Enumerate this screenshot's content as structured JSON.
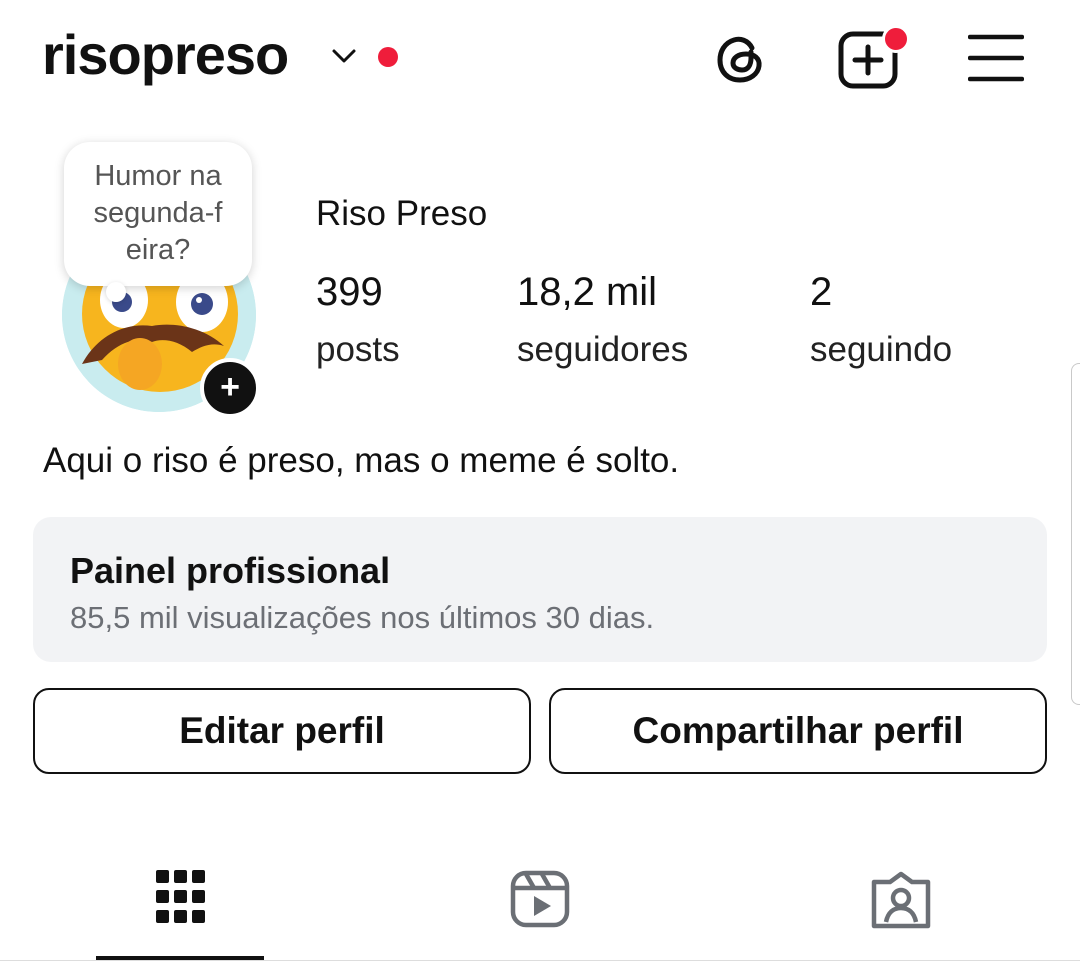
{
  "header": {
    "username": "risopreso",
    "icons": [
      "chevron-down-icon",
      "notification-dot",
      "threads-icon",
      "create-icon",
      "menu-icon"
    ],
    "accent_color": "#ef1d3b"
  },
  "profile": {
    "note_text": "Humor na segunda-f eira?",
    "note_lines": [
      "Humor na",
      "segunda-f",
      "eira?"
    ],
    "full_name": "Riso Preso",
    "stats": {
      "posts": {
        "value": "399",
        "label": "posts"
      },
      "followers": {
        "value": "18,2 mil",
        "label": "seguidores"
      },
      "following": {
        "value": "2",
        "label": "seguindo"
      }
    },
    "bio": "Aqui o riso é preso, mas o meme é solto."
  },
  "dashboard": {
    "title": "Painel profissional",
    "subtitle": "85,5 mil visualizações nos últimos 30 dias."
  },
  "buttons": {
    "edit": "Editar perfil",
    "share": "Compartilhar perfil"
  },
  "tabs": [
    {
      "name": "grid-icon",
      "active": true
    },
    {
      "name": "reels-icon",
      "active": false
    },
    {
      "name": "tagged-icon",
      "active": false
    }
  ]
}
